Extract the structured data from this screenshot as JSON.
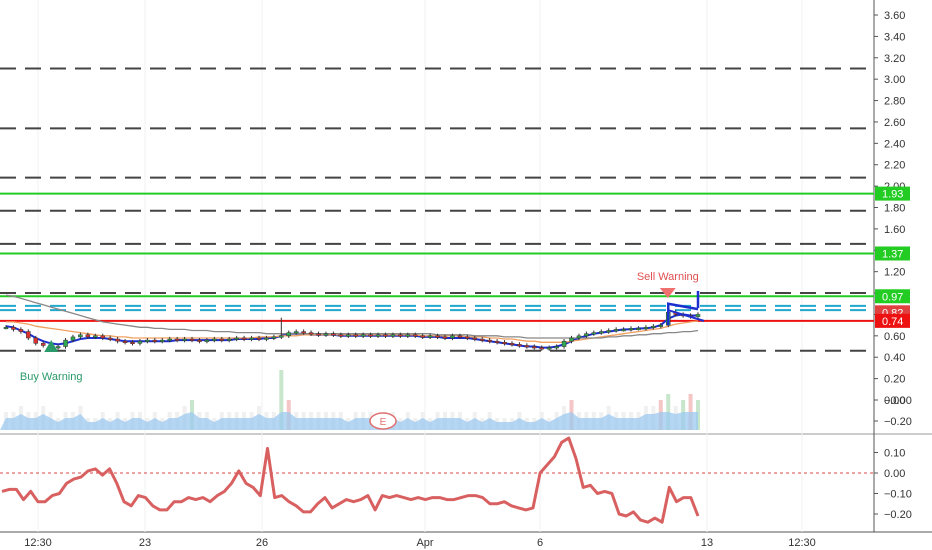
{
  "chart_data": [
    {
      "type": "candlestick",
      "pane": "price",
      "y_axis_ticks": [
        "3.60",
        "3.40",
        "3.20",
        "3.00",
        "2.80",
        "2.60",
        "2.40",
        "2.20",
        "2.00",
        "1.80",
        "1.60",
        "1.40",
        "1.20",
        "1.00",
        "0.80",
        "0.60",
        "0.40",
        "0.20",
        "0.00",
        "−0.00",
        "−0.20"
      ],
      "ylim": [
        -0.23,
        3.7
      ],
      "x_ticks": [
        "12:30",
        "23",
        "26",
        "Apr",
        "6",
        "13",
        "12:30"
      ],
      "close": [
        0.68,
        0.66,
        0.64,
        0.58,
        0.53,
        0.51,
        0.49,
        0.5,
        0.56,
        0.59,
        0.61,
        0.59,
        0.6,
        0.58,
        0.57,
        0.55,
        0.54,
        0.53,
        0.55,
        0.56,
        0.55,
        0.56,
        0.57,
        0.56,
        0.57,
        0.56,
        0.55,
        0.56,
        0.57,
        0.56,
        0.57,
        0.58,
        0.57,
        0.58,
        0.57,
        0.58,
        0.59,
        0.6,
        0.63,
        0.64,
        0.63,
        0.62,
        0.61,
        0.62,
        0.61,
        0.6,
        0.61,
        0.6,
        0.61,
        0.6,
        0.61,
        0.6,
        0.61,
        0.6,
        0.61,
        0.6,
        0.59,
        0.6,
        0.59,
        0.58,
        0.6,
        0.59,
        0.58,
        0.57,
        0.56,
        0.55,
        0.54,
        0.53,
        0.52,
        0.51,
        0.5,
        0.49,
        0.48,
        0.49,
        0.5,
        0.55,
        0.58,
        0.6,
        0.62,
        0.63,
        0.64,
        0.65,
        0.66,
        0.66,
        0.67,
        0.67,
        0.68,
        0.69,
        0.7,
        0.82,
        0.8,
        0.79,
        0.78,
        0.8
      ],
      "high_wicks": [
        {
          "index": 37,
          "value": 0.77
        }
      ],
      "buy_warning_index": 5,
      "sell_warning_index": 88,
      "moving_averages": [
        {
          "color": "#1e2fd0",
          "values": [
            0.69,
            0.68,
            0.65,
            0.62,
            0.58,
            0.55,
            0.53,
            0.52,
            0.53,
            0.55,
            0.57,
            0.58,
            0.58,
            0.58,
            0.57,
            0.56,
            0.55,
            0.55,
            0.55,
            0.55,
            0.55,
            0.55,
            0.55,
            0.56,
            0.56,
            0.56,
            0.56,
            0.56,
            0.56,
            0.56,
            0.56,
            0.57,
            0.57,
            0.57,
            0.57,
            0.58,
            0.58,
            0.6,
            0.62,
            0.62,
            0.62,
            0.61,
            0.61,
            0.61,
            0.61,
            0.6,
            0.6,
            0.6,
            0.6,
            0.6,
            0.6,
            0.6,
            0.6,
            0.6,
            0.6,
            0.6,
            0.59,
            0.59,
            0.59,
            0.58,
            0.58,
            0.58,
            0.58,
            0.57,
            0.56,
            0.55,
            0.54,
            0.53,
            0.52,
            0.51,
            0.5,
            0.5,
            0.49,
            0.49,
            0.5,
            0.52,
            0.55,
            0.58,
            0.6,
            0.62,
            0.63,
            0.64,
            0.65,
            0.66,
            0.66,
            0.67,
            0.67,
            0.68,
            0.7,
            0.76,
            0.79,
            0.8,
            0.79,
            0.79
          ]
        },
        {
          "color": "#f0a060",
          "values": [
            0.73,
            0.73,
            0.72,
            0.71,
            0.69,
            0.68,
            0.67,
            0.66,
            0.65,
            0.64,
            0.63,
            0.62,
            0.61,
            0.6,
            0.6,
            0.59,
            0.59,
            0.58,
            0.58,
            0.58,
            0.58,
            0.58,
            0.58,
            0.58,
            0.58,
            0.58,
            0.58,
            0.58,
            0.58,
            0.58,
            0.58,
            0.58,
            0.58,
            0.58,
            0.59,
            0.59,
            0.59,
            0.6,
            0.6,
            0.6,
            0.61,
            0.61,
            0.61,
            0.61,
            0.61,
            0.61,
            0.61,
            0.61,
            0.61,
            0.61,
            0.61,
            0.61,
            0.61,
            0.61,
            0.61,
            0.61,
            0.6,
            0.6,
            0.6,
            0.6,
            0.6,
            0.6,
            0.59,
            0.59,
            0.59,
            0.58,
            0.58,
            0.57,
            0.57,
            0.56,
            0.55,
            0.55,
            0.54,
            0.54,
            0.54,
            0.54,
            0.55,
            0.56,
            0.57,
            0.58,
            0.59,
            0.6,
            0.61,
            0.62,
            0.63,
            0.64,
            0.65,
            0.66,
            0.67,
            0.69,
            0.71,
            0.72,
            0.73,
            0.74
          ]
        },
        {
          "color": "#888888",
          "values": [
            0.98,
            0.97,
            0.95,
            0.93,
            0.91,
            0.89,
            0.87,
            0.85,
            0.83,
            0.81,
            0.79,
            0.77,
            0.75,
            0.73,
            0.72,
            0.71,
            0.7,
            0.69,
            0.68,
            0.68,
            0.67,
            0.67,
            0.66,
            0.66,
            0.66,
            0.65,
            0.65,
            0.65,
            0.64,
            0.64,
            0.64,
            0.63,
            0.63,
            0.63,
            0.63,
            0.62,
            0.62,
            0.62,
            0.62,
            0.62,
            0.62,
            0.62,
            0.62,
            0.62,
            0.62,
            0.62,
            0.62,
            0.62,
            0.62,
            0.62,
            0.62,
            0.62,
            0.62,
            0.62,
            0.62,
            0.62,
            0.62,
            0.62,
            0.61,
            0.61,
            0.61,
            0.61,
            0.61,
            0.6,
            0.6,
            0.6,
            0.6,
            0.59,
            0.59,
            0.59,
            0.58,
            0.58,
            0.58,
            0.58,
            0.58,
            0.58,
            0.58,
            0.58,
            0.58,
            0.58,
            0.58,
            0.59,
            0.59,
            0.6,
            0.6,
            0.61,
            0.61,
            0.62,
            0.62,
            0.63,
            0.63,
            0.64,
            0.64,
            0.65
          ]
        }
      ],
      "volume": [
        0.3,
        0.3,
        0.4,
        0.3,
        0.3,
        0.4,
        0.3,
        0.2,
        0.3,
        0.3,
        0.4,
        0.2,
        0.2,
        0.3,
        0.2,
        0.3,
        0.2,
        0.3,
        0.3,
        0.2,
        0.3,
        0.2,
        0.3,
        0.3,
        0.4,
        0.5,
        0.3,
        0.3,
        0.2,
        0.3,
        0.3,
        0.3,
        0.3,
        0.3,
        0.4,
        0.3,
        0.3,
        1.0,
        0.5,
        0.3,
        0.3,
        0.3,
        0.3,
        0.3,
        0.3,
        0.3,
        0.2,
        0.3,
        0.3,
        0.3,
        0.2,
        0.3,
        0.3,
        0.2,
        0.3,
        0.2,
        0.3,
        0.2,
        0.3,
        0.3,
        0.3,
        0.3,
        0.2,
        0.3,
        0.2,
        0.3,
        0.2,
        0.2,
        0.2,
        0.3,
        0.2,
        0.2,
        0.3,
        0.2,
        0.3,
        0.4,
        0.5,
        0.3,
        0.3,
        0.3,
        0.3,
        0.4,
        0.3,
        0.3,
        0.3,
        0.3,
        0.4,
        0.4,
        0.5,
        0.6,
        0.4,
        0.5,
        0.6,
        0.5
      ],
      "horizontal_levels": [
        {
          "value": 3.1,
          "style": "dashed",
          "color": "#444444"
        },
        {
          "value": 2.54,
          "style": "dashed",
          "color": "#444444"
        },
        {
          "value": 2.08,
          "style": "dashed",
          "color": "#444444"
        },
        {
          "value": 1.77,
          "style": "dashed",
          "color": "#444444"
        },
        {
          "value": 1.46,
          "style": "dashed",
          "color": "#444444"
        },
        {
          "value": 1.0,
          "style": "dashed",
          "color": "#444444"
        },
        {
          "value": 0.46,
          "style": "dashed",
          "color": "#444444"
        },
        {
          "value": 1.93,
          "style": "solid",
          "color": "#22cc22"
        },
        {
          "value": 1.37,
          "style": "solid",
          "color": "#22cc22"
        },
        {
          "value": 0.97,
          "style": "solid",
          "color": "#22cc22"
        },
        {
          "value": 0.88,
          "style": "dashed",
          "color": "#22a8cc"
        },
        {
          "value": 0.84,
          "style": "dashed",
          "color": "#22a8cc"
        },
        {
          "value": 0.74,
          "style": "solid",
          "color": "#ee1111"
        }
      ],
      "price_labels": [
        {
          "text": "1.93",
          "value": 1.93,
          "color": "#22cc22"
        },
        {
          "text": "1.37",
          "value": 1.37,
          "color": "#22cc22"
        },
        {
          "text": "0.97",
          "value": 0.97,
          "color": "#22cc22"
        },
        {
          "text": "0.82",
          "value": 0.82,
          "color": "#e04040"
        },
        {
          "text": "0.74",
          "value": 0.74,
          "color": "#ee1111"
        }
      ],
      "annotations": [
        "Buy Warning",
        "Sell Warning"
      ],
      "earnings_marker": "E"
    },
    {
      "type": "line",
      "pane": "oscillator",
      "y_axis_ticks": [
        "0.10",
        "0.00",
        "−0.10",
        "−0.20"
      ],
      "ylim": [
        -0.25,
        0.17
      ],
      "zero_line_color": "#dd4444",
      "series_color": "#d96060",
      "values": [
        -0.09,
        -0.08,
        -0.08,
        -0.13,
        -0.09,
        -0.14,
        -0.14,
        -0.11,
        -0.1,
        -0.05,
        -0.03,
        -0.02,
        0.01,
        0.02,
        -0.01,
        0.02,
        -0.05,
        -0.14,
        -0.16,
        -0.11,
        -0.12,
        -0.16,
        -0.18,
        -0.18,
        -0.14,
        -0.14,
        -0.12,
        -0.13,
        -0.12,
        -0.14,
        -0.11,
        -0.09,
        -0.05,
        0.01,
        -0.05,
        -0.07,
        -0.11,
        0.12,
        -0.12,
        -0.11,
        -0.14,
        -0.16,
        -0.19,
        -0.19,
        -0.15,
        -0.12,
        -0.17,
        -0.15,
        -0.13,
        -0.14,
        -0.13,
        -0.11,
        -0.18,
        -0.11,
        -0.12,
        -0.11,
        -0.12,
        -0.13,
        -0.12,
        -0.13,
        -0.12,
        -0.12,
        -0.13,
        -0.13,
        -0.12,
        -0.11,
        -0.11,
        -0.12,
        -0.15,
        -0.15,
        -0.14,
        -0.16,
        -0.17,
        -0.18,
        -0.17,
        0.0,
        0.04,
        0.08,
        0.15,
        0.17,
        0.07,
        -0.07,
        -0.06,
        -0.1,
        -0.09,
        -0.1,
        -0.2,
        -0.21,
        -0.19,
        -0.23,
        -0.24,
        -0.22,
        -0.24,
        -0.07,
        -0.14,
        -0.12,
        -0.12,
        -0.21
      ]
    }
  ]
}
